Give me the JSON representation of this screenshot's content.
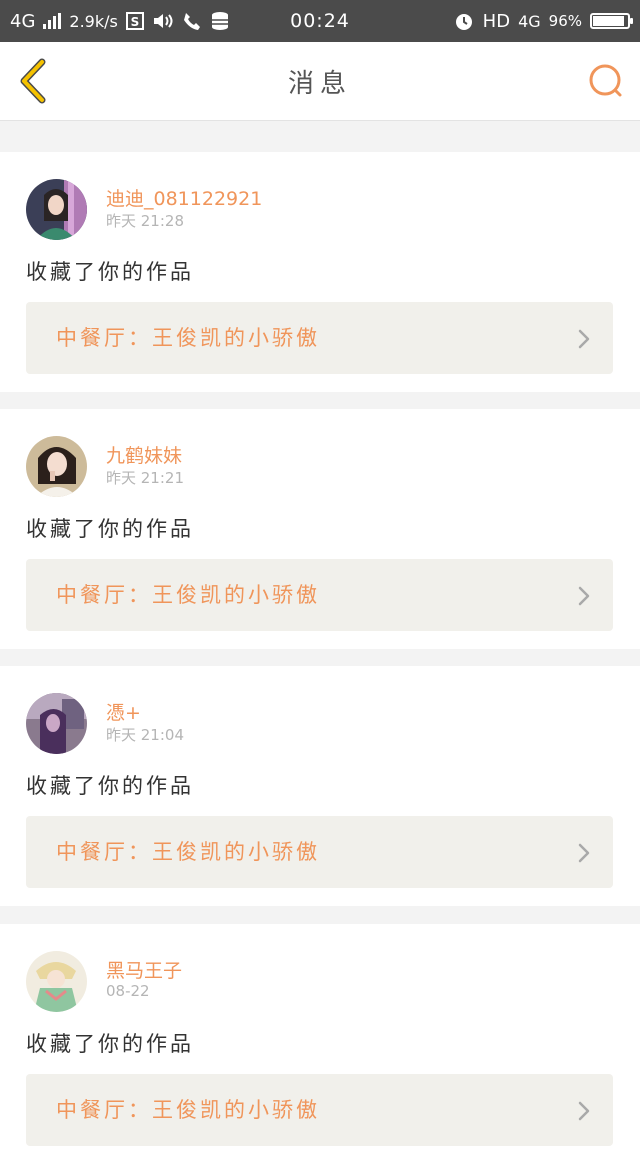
{
  "status_bar": {
    "network": "4G",
    "speed": "2.9k/s",
    "time": "00:24",
    "hd": "HD",
    "network2": "4G",
    "battery": "96%",
    "battery_level": 0.96
  },
  "nav": {
    "title": "消息",
    "back_icon": "chevron-left-icon",
    "search_icon": "search-icon"
  },
  "colors": {
    "accent": "#f0955a",
    "back_arrow": "#f5c200",
    "status_bar": "#4b4b4b"
  },
  "messages": [
    {
      "username": "迪迪_081122921",
      "time": "昨天 21:28",
      "action": "收藏了你的作品",
      "work_title": "中餐厅：王俊凯的小骄傲"
    },
    {
      "username": "九鹤妹妹",
      "time": "昨天 21:21",
      "action": "收藏了你的作品",
      "work_title": "中餐厅：王俊凯的小骄傲"
    },
    {
      "username": "憑+",
      "time": "昨天 21:04",
      "action": "收藏了你的作品",
      "work_title": "中餐厅：王俊凯的小骄傲"
    },
    {
      "username": "黑马王子",
      "time": "08-22",
      "action": "收藏了你的作品",
      "work_title": "中餐厅：王俊凯的小骄傲"
    }
  ]
}
